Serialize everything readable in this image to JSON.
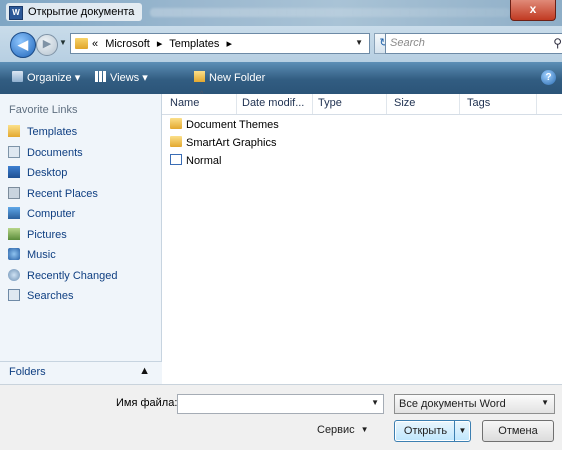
{
  "window": {
    "title": "Открытие документа",
    "close_label": "x",
    "app_icon_letter": "W"
  },
  "address": {
    "crumbs": [
      "«",
      "Microsoft",
      "▸",
      "Templates",
      "▸"
    ],
    "search_placeholder": "Search"
  },
  "toolbar": {
    "organize": "Organize ▾",
    "views": "Views ▾",
    "new_folder": "New Folder"
  },
  "nav": {
    "heading": "Favorite Links",
    "items": [
      {
        "label": "Templates",
        "icon": "folder-icon"
      },
      {
        "label": "Documents",
        "icon": "documents-icon"
      },
      {
        "label": "Desktop",
        "icon": "desktop-icon"
      },
      {
        "label": "Recent Places",
        "icon": "recent-places-icon"
      },
      {
        "label": "Computer",
        "icon": "computer-icon"
      },
      {
        "label": "Pictures",
        "icon": "pictures-icon"
      },
      {
        "label": "Music",
        "icon": "music-icon"
      },
      {
        "label": "Recently Changed",
        "icon": "recently-changed-icon"
      },
      {
        "label": "Searches",
        "icon": "searches-icon"
      }
    ],
    "folders_label": "Folders"
  },
  "columns": [
    "Name",
    "Date modif...",
    "Type",
    "Size",
    "Tags"
  ],
  "files": [
    {
      "name": "Document Themes",
      "kind": "folder"
    },
    {
      "name": "SmartArt Graphics",
      "kind": "folder"
    },
    {
      "name": "Normal",
      "kind": "word-template"
    }
  ],
  "bottom": {
    "filename_label": "Имя файла:",
    "filename_value": "",
    "filter": "Все документы Word",
    "service": "Сервис",
    "open": "Открыть",
    "cancel": "Отмена"
  },
  "colors": {
    "toolbar": "#325d82",
    "nav_text": "#0f3f82",
    "nav_bg": "#f0f5fa"
  }
}
